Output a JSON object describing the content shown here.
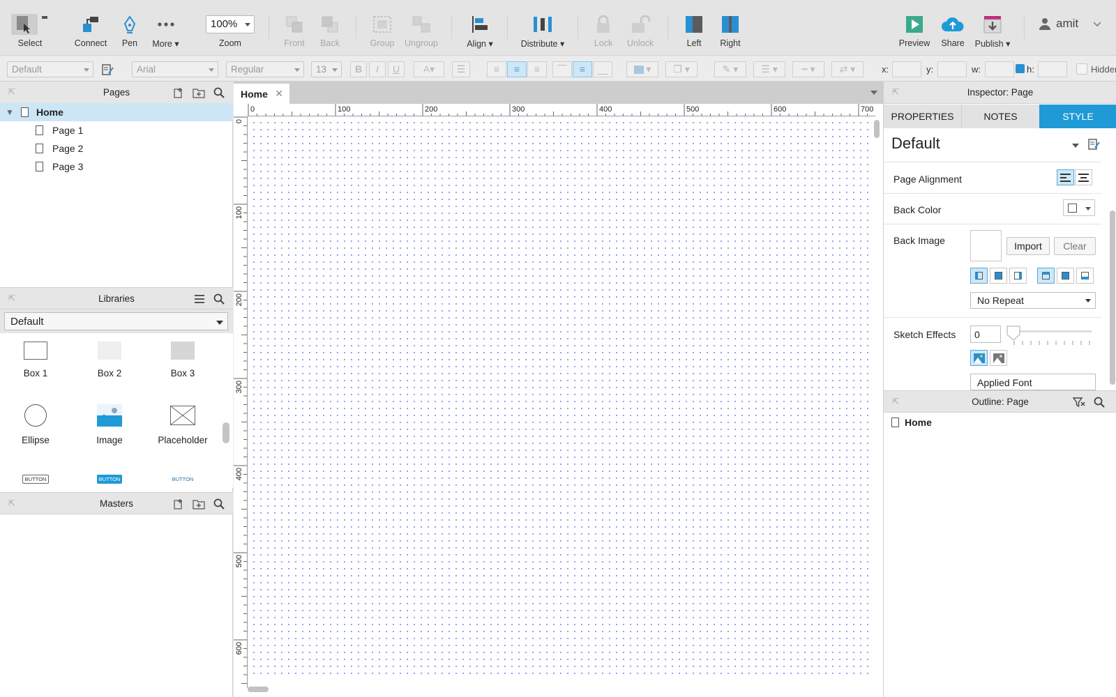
{
  "toolbar": {
    "select_label": "Select",
    "connect_label": "Connect",
    "pen_label": "Pen",
    "more_label": "More ▾",
    "zoom_value": "100%",
    "zoom_label": "Zoom",
    "front_label": "Front",
    "back_label": "Back",
    "group_label": "Group",
    "ungroup_label": "Ungroup",
    "align_label": "Align ▾",
    "distribute_label": "Distribute ▾",
    "lock_label": "Lock",
    "unlock_label": "Unlock",
    "left_label": "Left",
    "right_label": "Right",
    "preview_label": "Preview",
    "share_label": "Share",
    "publish_label": "Publish ▾",
    "user_name": "amit"
  },
  "format_bar": {
    "style": "Default",
    "font": "Arial",
    "weight": "Regular",
    "size": "13",
    "bold": "B",
    "italic": "I",
    "underline": "U",
    "x_label": "x:",
    "y_label": "y:",
    "w_label": "w:",
    "h_label": "h:",
    "hidden_label": "Hidden"
  },
  "pages_panel": {
    "title": "Pages",
    "root": "Home",
    "pages": [
      "Page 1",
      "Page 2",
      "Page 3"
    ]
  },
  "libraries_panel": {
    "title": "Libraries",
    "selected_library": "Default",
    "items": [
      {
        "label": "Box 1",
        "icon": "box1-icon"
      },
      {
        "label": "Box 2",
        "icon": "box2-icon"
      },
      {
        "label": "Box 3",
        "icon": "box3-icon"
      },
      {
        "label": "Ellipse",
        "icon": "ellipse-icon"
      },
      {
        "label": "Image",
        "icon": "image-icon"
      },
      {
        "label": "Placeholder",
        "icon": "placeholder-icon"
      }
    ],
    "button_widget_text": "BUTTON"
  },
  "masters_panel": {
    "title": "Masters"
  },
  "canvas": {
    "tab_label": "Home",
    "h_ruler": [
      "0",
      "100",
      "200",
      "300",
      "400",
      "500",
      "600",
      "700"
    ],
    "v_ruler": [
      "0",
      "100",
      "200",
      "300",
      "400",
      "500",
      "600"
    ]
  },
  "inspector": {
    "title": "Inspector: Page",
    "tabs": [
      "PROPERTIES",
      "NOTES",
      "STYLE"
    ],
    "active_tab": "STYLE",
    "style_name": "Default",
    "page_alignment_label": "Page Alignment",
    "back_color_label": "Back Color",
    "back_image_label": "Back Image",
    "import_label": "Import",
    "clear_label": "Clear",
    "repeat_value": "No Repeat",
    "sketch_effects_label": "Sketch Effects",
    "sketch_value": "0",
    "applied_font_label": "Applied Font"
  },
  "outline": {
    "title": "Outline: Page",
    "root": "Home"
  },
  "colors": {
    "accent": "#1f9ad6",
    "selection": "#cce6f6",
    "grid_dot": "#7c86f0",
    "preview": "#3aaa8c",
    "publish": "#c2297e"
  }
}
